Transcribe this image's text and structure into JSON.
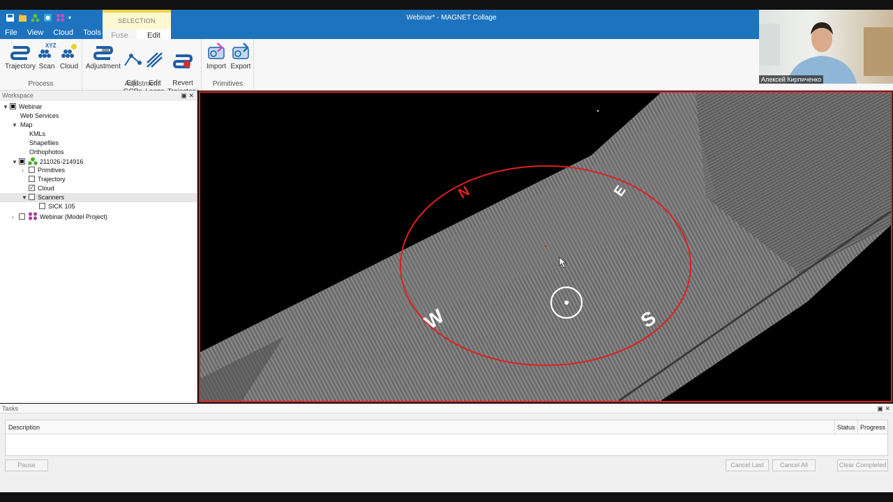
{
  "window": {
    "title": "Webinar* - MAGNET Collage"
  },
  "menu": [
    "File",
    "View",
    "Cloud",
    "Tools"
  ],
  "contextual": {
    "group_title": "SELECTION",
    "tabs": [
      "Fuse",
      "Edit"
    ]
  },
  "ribbon": {
    "groups": [
      {
        "name": "Process",
        "buttons": [
          "Trajectory",
          "Scan",
          "Cloud"
        ]
      },
      {
        "name": "Adjustment",
        "buttons": [
          "Adjustment",
          "Edit\nGCPs",
          "Edit\nLoops",
          "Revert\nTrajectory"
        ]
      },
      {
        "name": "Primitives",
        "buttons": [
          "Import",
          "Export"
        ]
      }
    ],
    "scan_icon_text": "XYZ"
  },
  "webcam": {
    "name": "Алексей Кирпиченко"
  },
  "workspace": {
    "title": "Workspace",
    "tree": [
      {
        "label": "Webinar"
      },
      {
        "label": "Web Services"
      },
      {
        "label": "Map"
      },
      {
        "label": "KMLs"
      },
      {
        "label": "Shapefiles"
      },
      {
        "label": "Orthophotos"
      },
      {
        "label": "211026-214916"
      },
      {
        "label": "Primitives"
      },
      {
        "label": "Trajectory"
      },
      {
        "label": "Cloud"
      },
      {
        "label": "Scanners"
      },
      {
        "label": "SICK 105"
      },
      {
        "label": "Webinar (Model Project)"
      }
    ]
  },
  "compass": {
    "n": "N",
    "e": "E",
    "s": "S",
    "w": "W"
  },
  "tasks": {
    "title": "Tasks",
    "columns": [
      "Description",
      "Status",
      "Progress"
    ],
    "buttons": {
      "pause": "Pause",
      "cancel_last": "Cancel Last",
      "cancel_all": "Cancel All",
      "clear_completed": "Clear Completed"
    }
  },
  "colors": {
    "accent": "#1e73be",
    "compass": "#e02020",
    "selection_tab": "#f0d24a"
  }
}
